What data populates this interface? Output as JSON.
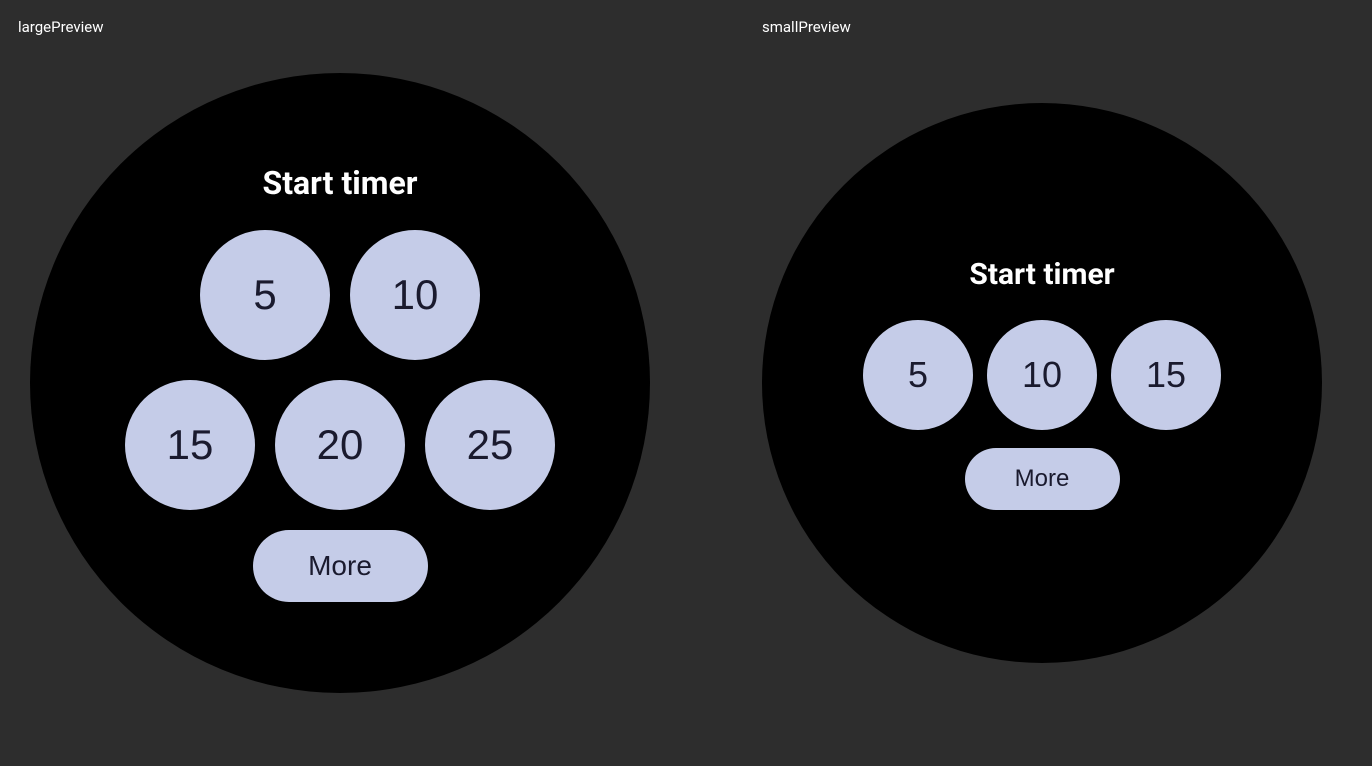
{
  "labels": {
    "large_preview": "largePreview",
    "small_preview": "smallPreview"
  },
  "large_watch": {
    "title": "Start timer",
    "buttons_row1": [
      "5",
      "10"
    ],
    "buttons_row2": [
      "15",
      "20",
      "25"
    ],
    "more_label": "More"
  },
  "small_watch": {
    "title": "Start timer",
    "buttons_row1": [
      "5",
      "10",
      "15"
    ],
    "more_label": "More"
  },
  "colors": {
    "background": "#2d2d2d",
    "watch_face": "#000000",
    "button_bg": "#c5cce8",
    "button_text": "#1a1a2e",
    "label_text": "#ffffff"
  }
}
